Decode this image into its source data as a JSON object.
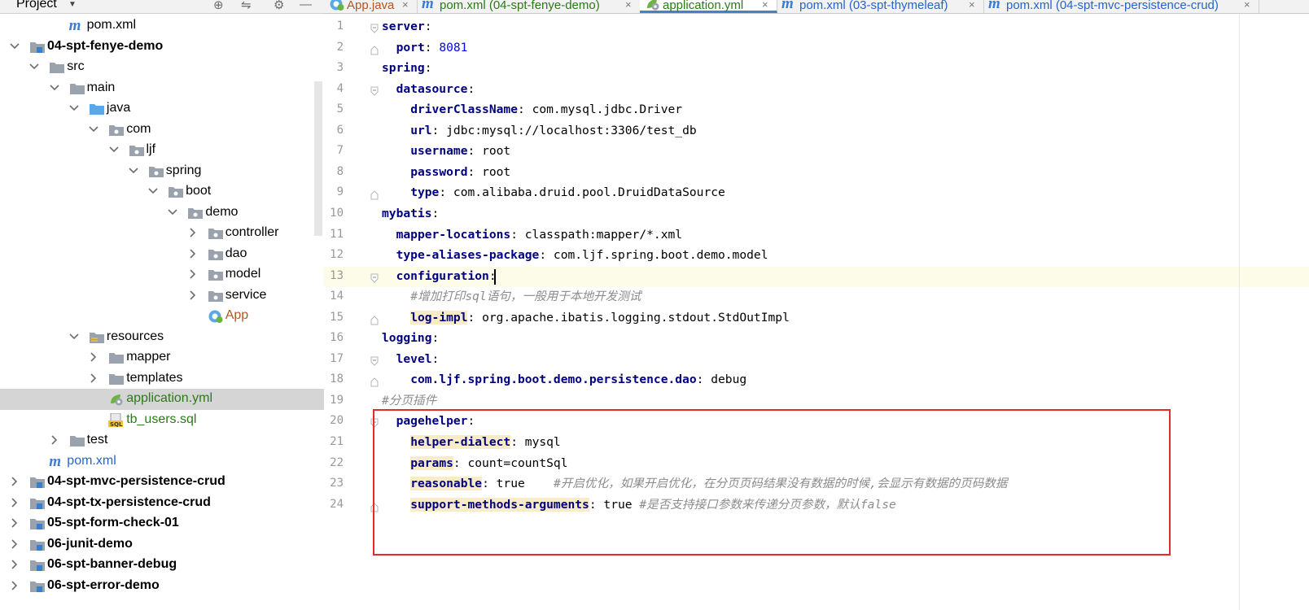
{
  "project_panel": {
    "title": "Project",
    "tree": [
      {
        "label": "pom.xml",
        "depth": 3,
        "arrow": "none",
        "icon": "maven",
        "style": "normal"
      },
      {
        "label": "04-spt-fenye-demo",
        "depth": 1,
        "arrow": "open",
        "icon": "module",
        "style": "bold"
      },
      {
        "label": "src",
        "depth": 2,
        "arrow": "open",
        "icon": "folder",
        "style": "normal"
      },
      {
        "label": "main",
        "depth": 3,
        "arrow": "open",
        "icon": "folder",
        "style": "normal"
      },
      {
        "label": "java",
        "depth": 4,
        "arrow": "open",
        "icon": "source-folder",
        "style": "normal"
      },
      {
        "label": "com",
        "depth": 5,
        "arrow": "open",
        "icon": "package",
        "style": "normal"
      },
      {
        "label": "ljf",
        "depth": 6,
        "arrow": "open",
        "icon": "package",
        "style": "normal"
      },
      {
        "label": "spring",
        "depth": 7,
        "arrow": "open",
        "icon": "package",
        "style": "normal"
      },
      {
        "label": "boot",
        "depth": 8,
        "arrow": "open",
        "icon": "package",
        "style": "normal"
      },
      {
        "label": "demo",
        "depth": 9,
        "arrow": "open",
        "icon": "package",
        "style": "normal"
      },
      {
        "label": "controller",
        "depth": 10,
        "arrow": "closed",
        "icon": "package",
        "style": "normal"
      },
      {
        "label": "dao",
        "depth": 10,
        "arrow": "closed",
        "icon": "package",
        "style": "normal"
      },
      {
        "label": "model",
        "depth": 10,
        "arrow": "closed",
        "icon": "package",
        "style": "normal"
      },
      {
        "label": "service",
        "depth": 10,
        "arrow": "closed",
        "icon": "package",
        "style": "normal"
      },
      {
        "label": "App",
        "depth": 10,
        "arrow": "none",
        "icon": "spring-class",
        "style": "orange"
      },
      {
        "label": "resources",
        "depth": 4,
        "arrow": "open",
        "icon": "resources-folder",
        "style": "normal"
      },
      {
        "label": "mapper",
        "depth": 5,
        "arrow": "closed",
        "icon": "folder",
        "style": "normal"
      },
      {
        "label": "templates",
        "depth": 5,
        "arrow": "closed",
        "icon": "folder",
        "style": "normal"
      },
      {
        "label": "application.yml",
        "depth": 5,
        "arrow": "none",
        "icon": "spring-yml",
        "style": "green",
        "selected": true
      },
      {
        "label": "tb_users.sql",
        "depth": 5,
        "arrow": "none",
        "icon": "sql",
        "style": "green"
      },
      {
        "label": "test",
        "depth": 3,
        "arrow": "closed",
        "icon": "folder",
        "style": "normal"
      },
      {
        "label": "pom.xml",
        "depth": 2,
        "arrow": "none",
        "icon": "maven",
        "style": "blue"
      },
      {
        "label": "04-spt-mvc-persistence-crud",
        "depth": 1,
        "arrow": "closed",
        "icon": "module",
        "style": "bold"
      },
      {
        "label": "04-spt-tx-persistence-crud",
        "depth": 1,
        "arrow": "closed",
        "icon": "module",
        "style": "bold"
      },
      {
        "label": "05-spt-form-check-01",
        "depth": 1,
        "arrow": "closed",
        "icon": "module",
        "style": "bold"
      },
      {
        "label": "06-junit-demo",
        "depth": 1,
        "arrow": "closed",
        "icon": "module",
        "style": "bold"
      },
      {
        "label": "06-spt-banner-debug",
        "depth": 1,
        "arrow": "closed",
        "icon": "module",
        "style": "bold"
      },
      {
        "label": "06-spt-error-demo",
        "depth": 1,
        "arrow": "closed",
        "icon": "module",
        "style": "bold"
      }
    ]
  },
  "tabs": [
    {
      "label": "App.java",
      "color": "#b4551e",
      "icon": "spring-class",
      "active": false
    },
    {
      "label": "pom.xml (04-spt-fenye-demo)",
      "color": "#2b7a17",
      "icon": "maven",
      "active": false
    },
    {
      "label": "application.yml",
      "color": "#2b7a17",
      "icon": "spring-yml",
      "active": true
    },
    {
      "label": "pom.xml (03-spt-thymeleaf)",
      "color": "#2864c8",
      "icon": "maven",
      "active": false
    },
    {
      "label": "pom.xml (04-spt-mvc-persistence-crud)",
      "color": "#2864c8",
      "icon": "maven",
      "active": false
    }
  ],
  "editor": {
    "current_line": 13,
    "lines": [
      {
        "n": "1",
        "indent": 0,
        "key": "server",
        "sep": ":",
        "val": "",
        "comment": "",
        "fold": "open"
      },
      {
        "n": "2",
        "indent": 1,
        "key": "port",
        "sep": ": ",
        "val": "8081",
        "num": true,
        "comment": "",
        "fold": "end"
      },
      {
        "n": "3",
        "indent": 0,
        "key": "spring",
        "sep": ":",
        "val": "",
        "comment": "",
        "fold": ""
      },
      {
        "n": "4",
        "indent": 1,
        "key": "datasource",
        "sep": ":",
        "val": "",
        "comment": "",
        "fold": "open"
      },
      {
        "n": "5",
        "indent": 2,
        "key": "driverClassName",
        "sep": ": ",
        "val": "com.mysql.jdbc.Driver",
        "comment": "",
        "fold": ""
      },
      {
        "n": "6",
        "indent": 2,
        "key": "url",
        "sep": ": ",
        "val": "jdbc:mysql://localhost:3306/test_db",
        "comment": "",
        "fold": ""
      },
      {
        "n": "7",
        "indent": 2,
        "key": "username",
        "sep": ": ",
        "val": "root",
        "comment": "",
        "fold": ""
      },
      {
        "n": "8",
        "indent": 2,
        "key": "password",
        "sep": ": ",
        "val": "root",
        "comment": "",
        "fold": ""
      },
      {
        "n": "9",
        "indent": 2,
        "key": "type",
        "sep": ": ",
        "val": "com.alibaba.druid.pool.DruidDataSource",
        "comment": "",
        "fold": "end"
      },
      {
        "n": "10",
        "indent": 0,
        "key": "mybatis",
        "sep": ":",
        "val": "",
        "comment": "",
        "fold": ""
      },
      {
        "n": "11",
        "indent": 1,
        "key": "mapper-locations",
        "sep": ": ",
        "val": "classpath:mapper/*.xml",
        "comment": "",
        "fold": ""
      },
      {
        "n": "12",
        "indent": 1,
        "key": "type-aliases-package",
        "sep": ": ",
        "val": "com.ljf.spring.boot.demo.model",
        "comment": "",
        "fold": ""
      },
      {
        "n": "13",
        "indent": 1,
        "key": "configuration",
        "sep": ":",
        "val": "",
        "comment": "",
        "fold": "open"
      },
      {
        "n": "14",
        "indent": 2,
        "key": "",
        "sep": "",
        "val": "",
        "comment": "#增加打印sql语句，一般用于本地开发测试",
        "fold": ""
      },
      {
        "n": "15",
        "indent": 2,
        "key": "log-impl",
        "sep": ": ",
        "val": "org.apache.ibatis.logging.stdout.StdOutImpl",
        "comment": "",
        "fold": "end",
        "hl": true
      },
      {
        "n": "16",
        "indent": 0,
        "key": "logging",
        "sep": ":",
        "val": "",
        "comment": "",
        "fold": ""
      },
      {
        "n": "17",
        "indent": 1,
        "key": "level",
        "sep": ":",
        "val": "",
        "comment": "",
        "fold": "open"
      },
      {
        "n": "18",
        "indent": 2,
        "key": "com.ljf.spring.boot.demo.persistence.dao",
        "sep": ": ",
        "val": "debug",
        "comment": "",
        "fold": "end"
      },
      {
        "n": "19",
        "indent": 0,
        "key": "",
        "sep": "",
        "val": "",
        "comment": "#分页插件",
        "fold": ""
      },
      {
        "n": "20",
        "indent": 1,
        "key": "pagehelper",
        "sep": ":",
        "val": "",
        "comment": "",
        "fold": "open"
      },
      {
        "n": "21",
        "indent": 2,
        "key": "helper-dialect",
        "sep": ": ",
        "val": "mysql",
        "comment": "",
        "fold": "",
        "hl": true
      },
      {
        "n": "22",
        "indent": 2,
        "key": "params",
        "sep": ": ",
        "val": "count=countSql",
        "comment": "",
        "fold": "",
        "hl": true
      },
      {
        "n": "23",
        "indent": 2,
        "key": "reasonable",
        "sep": ": ",
        "val": "true    ",
        "comment": "#开启优化，如果开启优化，在分页页码结果没有数据的时候,会显示有数据的页码数据",
        "fold": "",
        "hl": true
      },
      {
        "n": "24",
        "indent": 2,
        "key": "support-methods-arguments",
        "sep": ": ",
        "val": "true ",
        "comment": "#是否支持接口参数来传递分页参数，默认false",
        "fold": "end",
        "hl": true
      }
    ]
  },
  "colors": {
    "selection_row": "#d5d5d5",
    "yaml_key": "#000080",
    "comment": "#8c8c8c",
    "annotation_box": "#e52a2a",
    "active_tab_underline": "#4083c9"
  }
}
